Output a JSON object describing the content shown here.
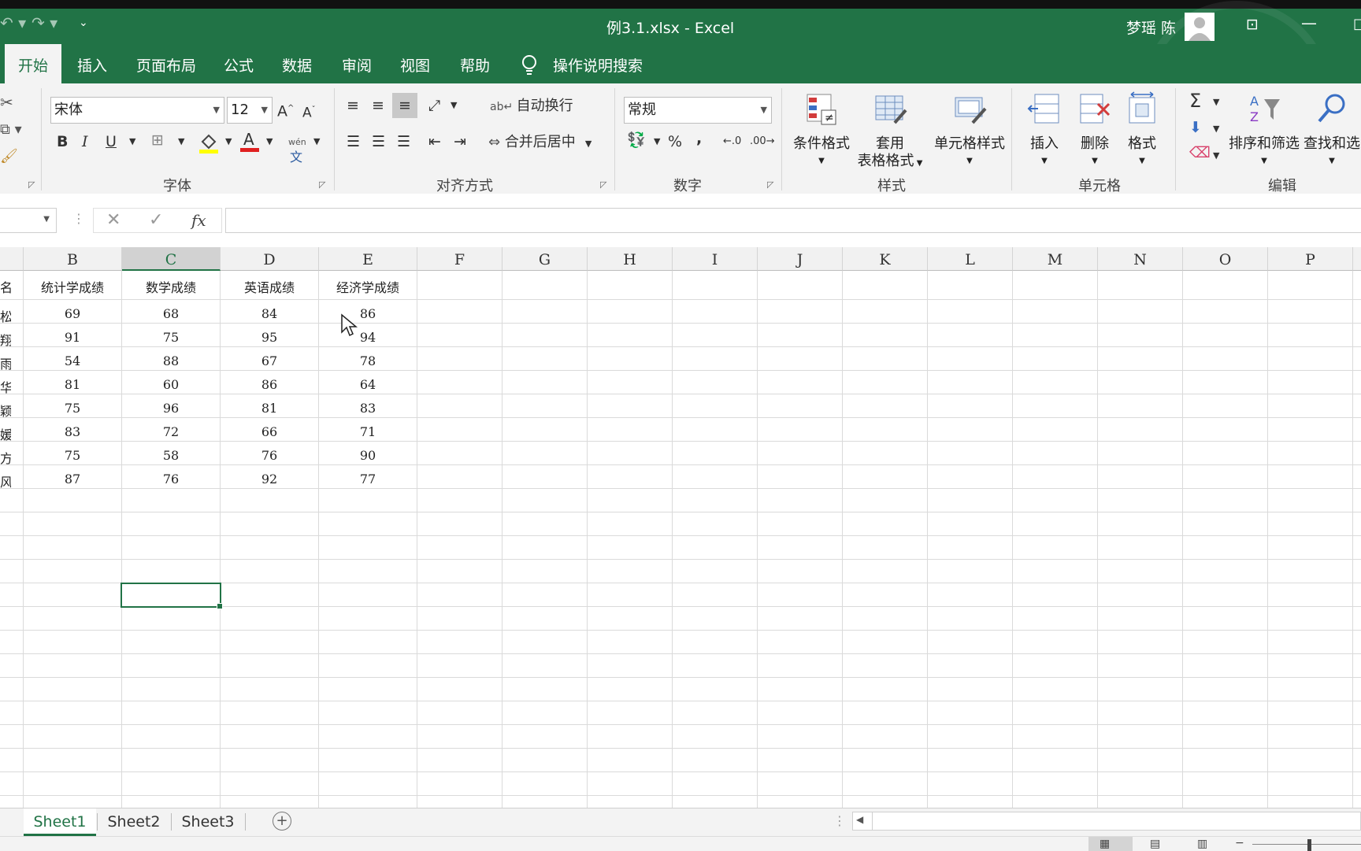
{
  "title_bar": {
    "doc_title": "例3.1.xlsx  -  Excel",
    "user_name": "梦瑶 陈"
  },
  "ribbon_tabs": [
    "开始",
    "插入",
    "页面布局",
    "公式",
    "数据",
    "审阅",
    "视图",
    "帮助"
  ],
  "search_label": "操作说明搜索",
  "font_group": {
    "font_name": "宋体",
    "font_size": "12",
    "label": "字体",
    "phonetic_top": "wén",
    "phonetic_bottom": "文"
  },
  "align_group": {
    "wrap_label": "自动换行",
    "merge_label": "合并后居中",
    "label": "对齐方式"
  },
  "number_group": {
    "format": "常规",
    "label": "数字",
    "percent": "%",
    "comma": ",",
    "inc_dec": ".00",
    "dec_dec": ".0"
  },
  "styles_group": {
    "conditional": "条件格式",
    "table_line1": "套用",
    "table_line2": "表格格式",
    "cell_styles": "单元格样式",
    "label": "样式"
  },
  "cells_group": {
    "insert": "插入",
    "delete": "删除",
    "format": "格式",
    "label": "单元格"
  },
  "editing_group": {
    "sort_filter": "排序和筛选",
    "find_select": "查找和选",
    "label": "编辑",
    "sum": "Σ"
  },
  "formula_bar": {
    "fx": "fx",
    "value": ""
  },
  "columns": [
    "B",
    "C",
    "D",
    "E",
    "F",
    "G",
    "H",
    "I",
    "J",
    "K",
    "L",
    "M",
    "N",
    "O",
    "P"
  ],
  "header_row": {
    "a": "名",
    "b": "统计学成绩",
    "c": "数学成绩",
    "d": "英语成绩",
    "e": "经济学成绩"
  },
  "rows": [
    {
      "a": "松",
      "b": "69",
      "c": "68",
      "d": "84",
      "e": "86"
    },
    {
      "a": "翔",
      "b": "91",
      "c": "75",
      "d": "95",
      "e": "94"
    },
    {
      "a": "雨",
      "b": "54",
      "c": "88",
      "d": "67",
      "e": "78"
    },
    {
      "a": "华",
      "b": "81",
      "c": "60",
      "d": "86",
      "e": "64"
    },
    {
      "a": "颖",
      "b": "75",
      "c": "96",
      "d": "81",
      "e": "83"
    },
    {
      "a": "媛",
      "b": "83",
      "c": "72",
      "d": "66",
      "e": "71"
    },
    {
      "a": "方",
      "b": "75",
      "c": "58",
      "d": "76",
      "e": "90"
    },
    {
      "a": "风",
      "b": "87",
      "c": "76",
      "d": "92",
      "e": "77"
    }
  ],
  "sheet_tabs": [
    "Sheet1",
    "Sheet2",
    "Sheet3"
  ],
  "colors": {
    "excel_green": "#217346",
    "ribbon_bg": "#f3f3f3",
    "grid_line": "#dadada"
  }
}
